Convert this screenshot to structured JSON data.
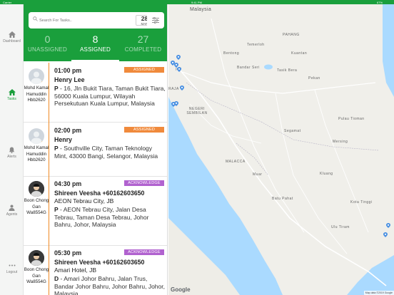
{
  "status_bar": {
    "carrier": "Carrier",
    "time": "9:41 PM",
    "battery": "67%"
  },
  "sidebar": {
    "items": [
      {
        "label": "Dashboard",
        "icon": "home-icon"
      },
      {
        "label": "Tasks",
        "icon": "tasks-home-icon",
        "active": true
      },
      {
        "label": "Alerts",
        "icon": "bell-icon"
      },
      {
        "label": "Agents",
        "icon": "person-icon"
      },
      {
        "label": "Logout",
        "icon": "more-dots-icon"
      }
    ]
  },
  "search": {
    "placeholder": "Search For Tasks..",
    "date_day": "28",
    "date_month": "MAR"
  },
  "tabs": [
    {
      "count": "0",
      "label": "UNASSIGNED"
    },
    {
      "count": "8",
      "label": "ASSIGNED",
      "active": true
    },
    {
      "count": "27",
      "label": "COMPLETED"
    }
  ],
  "tasks": [
    {
      "agent_name": "Mohd Kamal Hamuddin Hbb2620",
      "time": "01:00 pm",
      "status": "ASSIGNED",
      "customer": "Henry Lee",
      "address_prefix": "P",
      "address": "16, Jln Bukit Tiara, Taman Bukit Tiara, 56000 Kuala Lumpur, Wilayah Persekutuan Kuala Lumpur, Malaysia"
    },
    {
      "agent_name": "Mohd Kamal Hamuddin Hbb2620",
      "time": "02:00 pm",
      "status": "ASSIGNED",
      "customer": "Henry",
      "address_prefix": "P",
      "address": "Southville City, Taman Teknology Mint, 43000 Bangi, Selangor, Malaysia"
    },
    {
      "agent_name": "Boon Chong Gan Wa8554G",
      "time": "04:30 pm",
      "status": "ACKNOWLEDGE",
      "customer": "Shireen  Veesha +60162603650",
      "place": "AEON Tebrau City, JB",
      "address_prefix": "P",
      "address": "AEON Tebrau City, Jalan Desa Tebrau, Taman Desa Tebrau, Johor Bahru, Johor, Malaysia"
    },
    {
      "agent_name": "Boon Chong Gan Wa8554G",
      "time": "05:30 pm",
      "status": "ACKNOWLEDGE",
      "customer": "Shireen  Veesha +60162603650",
      "place": "Amari Hotel, JB",
      "address_prefix": "D",
      "address": "Amari Johor Bahru, Jalan Trus, Bandar Johor Bahru, Johor Bahru, Johor, Malaysia"
    }
  ],
  "map": {
    "labels": {
      "country": "Malaysia",
      "state_ns": "NEGERI SEMBILAN",
      "melaka": "MALACCA",
      "pahang": "PAHANG",
      "tioman": "Pulau Tioman",
      "city1": "Bandar Seri",
      "city2": "Bentong",
      "city3": "Segamat",
      "city4": "Kluang",
      "city5": "Mersing",
      "city6": "Batu Pahat",
      "city7": "Muar",
      "city8": "Kota Tinggi",
      "city9": "Ulu Tiram",
      "city10": "Kuantan",
      "city11": "Temerloh",
      "city12": "Pekan",
      "city13": "Tasik Bera",
      "lumpur_fragment": "pur",
      "raja_fragment": "RAJA"
    },
    "google": "Google",
    "footer": "Map data ©2019 Google"
  },
  "colors": {
    "brand": "#1a9f3c",
    "assigned": "#f08a3c",
    "acknowledge": "#b162cf",
    "timeline": "#f08a24"
  }
}
